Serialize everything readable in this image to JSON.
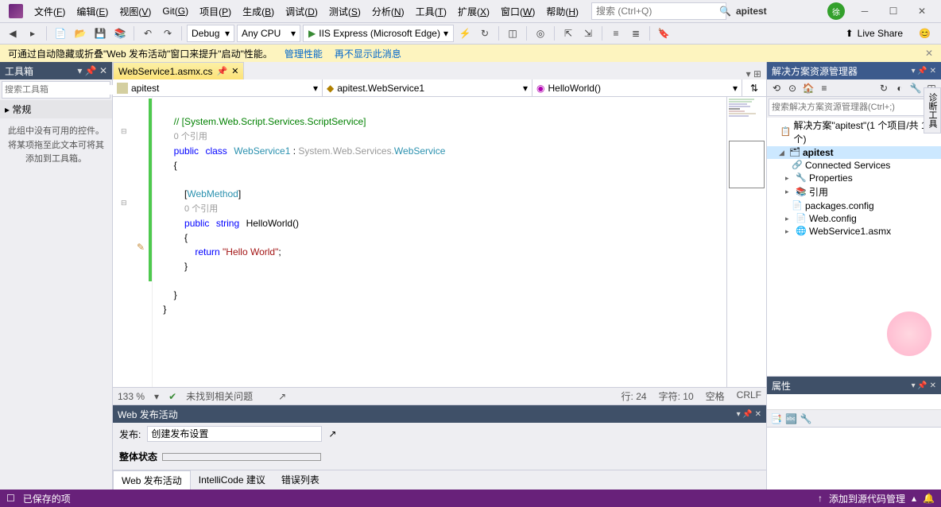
{
  "menubar": {
    "items": [
      {
        "label": "文件",
        "key": "F"
      },
      {
        "label": "编辑",
        "key": "E"
      },
      {
        "label": "视图",
        "key": "V"
      },
      {
        "label": "Git",
        "key": "G"
      },
      {
        "label": "项目",
        "key": "P"
      },
      {
        "label": "生成",
        "key": "B"
      },
      {
        "label": "调试",
        "key": "D"
      },
      {
        "label": "测试",
        "key": "S"
      },
      {
        "label": "分析",
        "key": "N"
      },
      {
        "label": "工具",
        "key": "T"
      },
      {
        "label": "扩展",
        "key": "X"
      },
      {
        "label": "窗口",
        "key": "W"
      },
      {
        "label": "帮助",
        "key": "H"
      }
    ],
    "search_placeholder": "搜索 (Ctrl+Q)",
    "solution_name": "apitest",
    "avatar_text": "徐"
  },
  "toolbar": {
    "config": "Debug",
    "platform": "Any CPU",
    "run_label": "IIS Express (Microsoft Edge)",
    "live_share": "Live Share"
  },
  "infobar": {
    "message": "可通过自动隐藏或折叠\"Web 发布活动\"窗口来提升\"启动\"性能。",
    "link1": "管理性能",
    "link2": "再不显示此消息"
  },
  "toolbox": {
    "title": "工具箱",
    "search_placeholder": "搜索工具箱",
    "category": "常规",
    "empty_text": "此组中没有可用的控件。将某项拖至此文本可将其添加到工具箱。"
  },
  "editor": {
    "tab_name": "WebService1.asmx.cs",
    "nav1": "apitest",
    "nav2": "apitest.WebService1",
    "nav3": "HelloWorld()",
    "zoom": "133 %",
    "issues": "未找到相关问题",
    "line_label": "行:",
    "line": "24",
    "col_label": "字符:",
    "col": "10",
    "ins": "空格",
    "eol": "CRLF",
    "code": {
      "l1a": "// [System.Web.Script.Services.ScriptService]",
      "l1ref": "0 个引用",
      "l2_kw1": "public",
      "l2_kw2": "class",
      "l2_name": "WebService1",
      "l2_sep": " : ",
      "l2_base": "System.Web.Services.",
      "l2_basecls": "WebService",
      "l3": "{",
      "l5": "[",
      "l5attr": "WebMethod",
      "l5b": "]",
      "l5ref": "0 个引用",
      "l6_kw1": "public",
      "l6_kw2": "string",
      "l6_name": "HelloWorld",
      "l6_paren": "()",
      "l7": "{",
      "l8_kw": "return",
      "l8_str": " \"Hello World\"",
      "l8_semi": ";",
      "l9": "}",
      "l11": "}",
      "l12": "}"
    }
  },
  "publish": {
    "title": "Web 发布活动",
    "label_publish": "发布:",
    "profile": "创建发布设置",
    "status_label": "整体状态",
    "tabs": [
      "Web 发布活动",
      "IntelliCode 建议",
      "错误列表"
    ]
  },
  "solution_explorer": {
    "title": "解决方案资源管理器",
    "search_placeholder": "搜索解决方案资源管理器(Ctrl+;)",
    "root": "解决方案\"apitest\"(1 个项目/共 1 个)",
    "project": "apitest",
    "items": [
      "Connected Services",
      "Properties",
      "引用",
      "packages.config",
      "Web.config",
      "WebService1.asmx"
    ]
  },
  "properties": {
    "title": "属性"
  },
  "statusbar": {
    "saved": "已保存的项",
    "add_source": "添加到源代码管理"
  },
  "vertical_tab": "诊断工具"
}
